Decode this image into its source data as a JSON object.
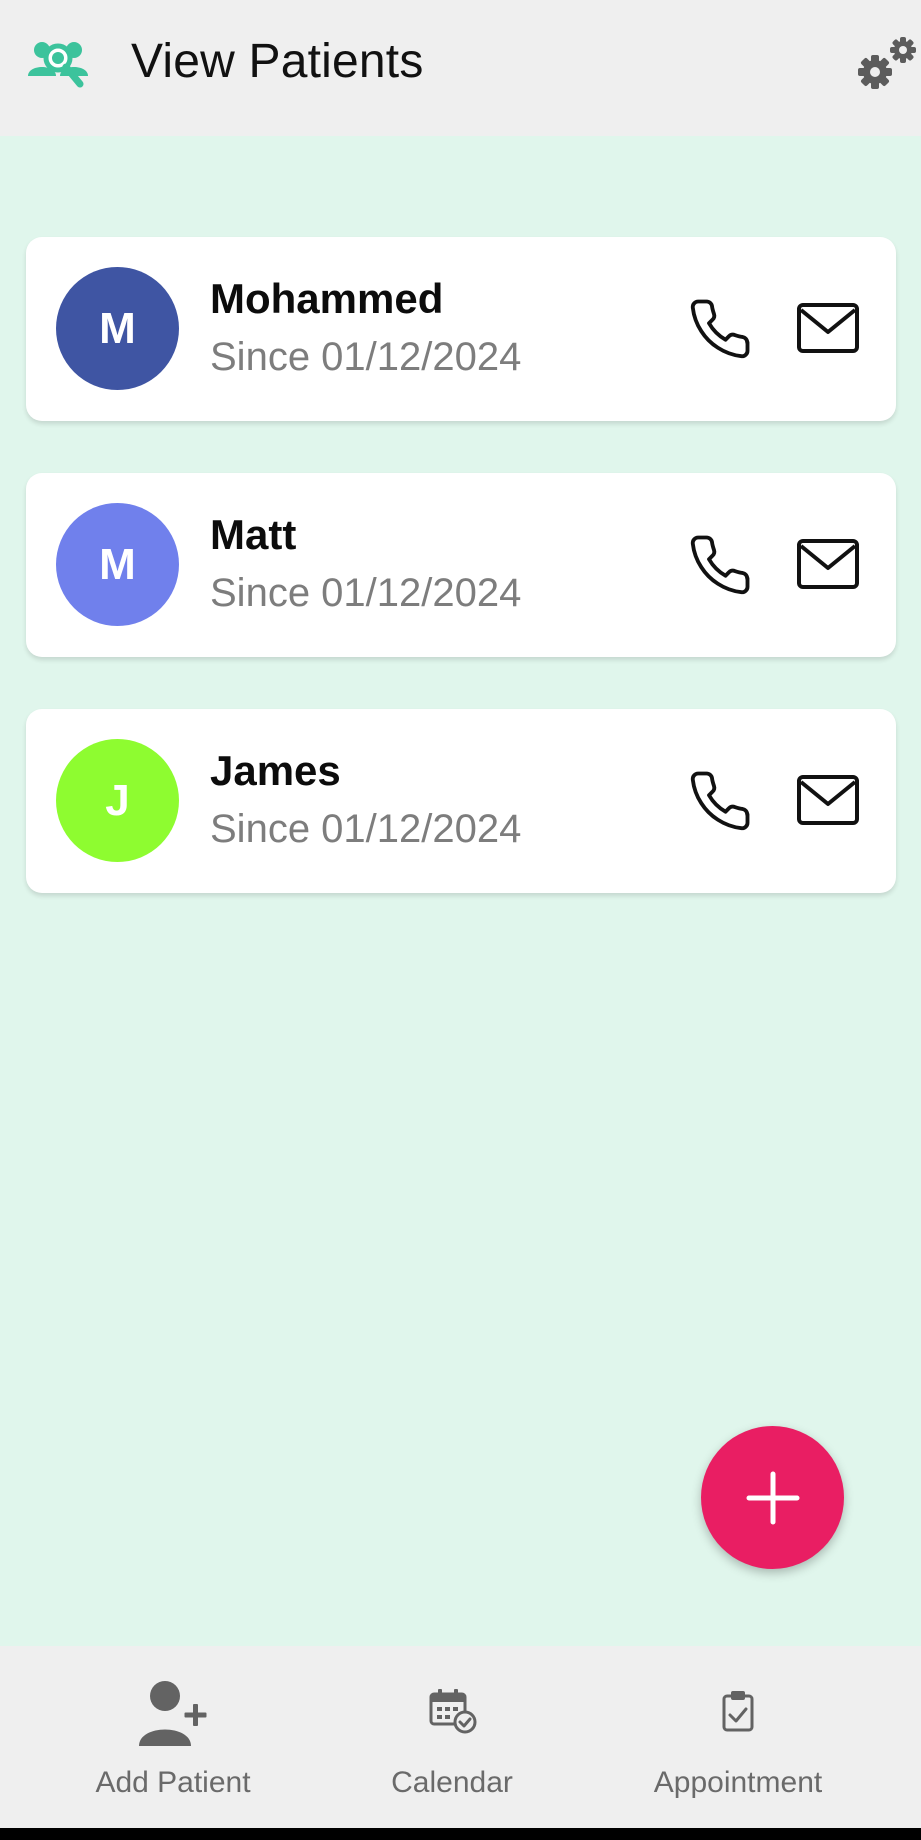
{
  "header": {
    "title": "View Patients",
    "icon": "patient-search-icon",
    "settings_icon": "gears-icon",
    "background": "#efefef",
    "accent": "#3cc39c"
  },
  "patients": [
    {
      "initial": "M",
      "name": "Mohammed",
      "since": "Since 01/12/2024",
      "avatar_color": "#3f55a3"
    },
    {
      "initial": "M",
      "name": "Matt",
      "since": "Since 01/12/2024",
      "avatar_color": "#7080ec"
    },
    {
      "initial": "J",
      "name": "James",
      "since": "Since 01/12/2024",
      "avatar_color": "#8efc30"
    }
  ],
  "card_actions": {
    "call_icon": "phone-icon",
    "mail_icon": "mail-icon"
  },
  "fab": {
    "icon": "plus-icon",
    "color": "#e91e63"
  },
  "bottom_nav": {
    "add_patient": {
      "label": "Add Patient",
      "icon": "add-user-icon"
    },
    "calendar": {
      "label": "Calendar",
      "icon": "calendar-check-icon"
    },
    "appointment": {
      "label": "Appointment",
      "icon": "clipboard-check-icon"
    }
  },
  "colors": {
    "page_background": "#e0f6ec",
    "secondary_text": "#7d7d7d"
  }
}
